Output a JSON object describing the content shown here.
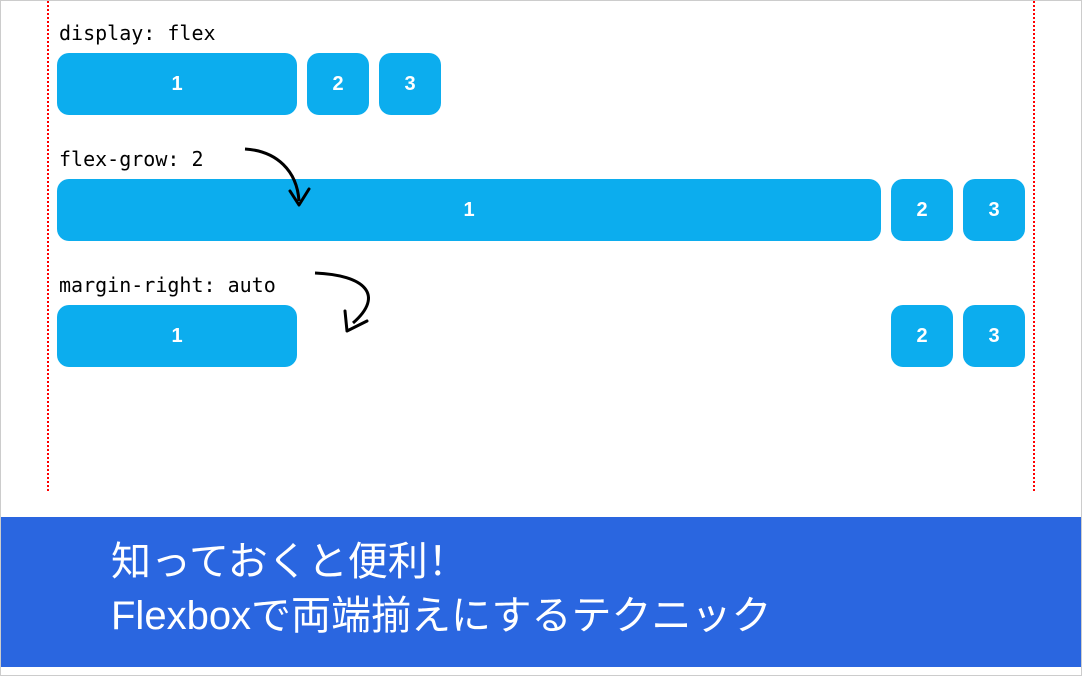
{
  "examples": [
    {
      "label": "display: flex",
      "boxes": [
        "1",
        "2",
        "3"
      ]
    },
    {
      "label": "flex-grow: 2",
      "boxes": [
        "1",
        "2",
        "3"
      ]
    },
    {
      "label": "margin-right: auto",
      "boxes": [
        "1",
        "2",
        "3"
      ]
    }
  ],
  "banner": {
    "line1": "知っておくと便利！",
    "line2": "Flexboxで両端揃えにするテクニック"
  },
  "colors": {
    "box": "#0CADEE",
    "banner": "#2A66E0",
    "guideline": "#ff0000"
  }
}
